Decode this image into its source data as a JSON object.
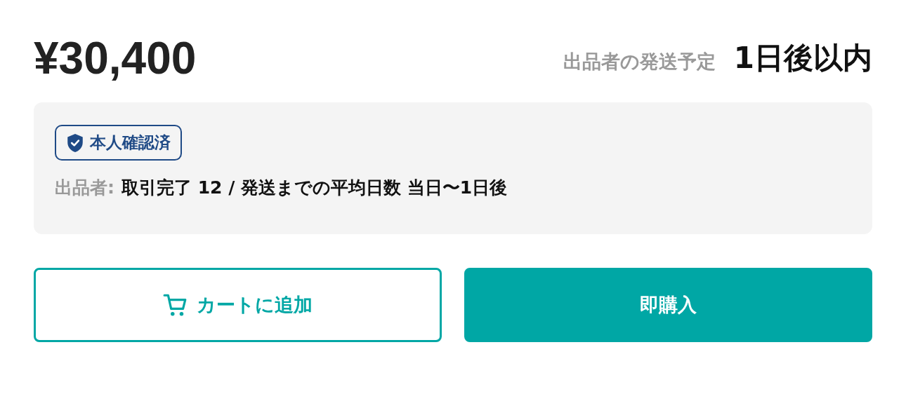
{
  "price": "¥30,400",
  "shipping": {
    "label": "出品者の発送予定",
    "value": "1日後以内"
  },
  "seller": {
    "verified_badge": "本人確認済",
    "label": "出品者:",
    "stats": "取引完了 12 / 発送までの平均日数 当日〜1日後"
  },
  "buttons": [
    {
      "kind": "outline",
      "label": "カートに追加"
    },
    {
      "kind": "filled",
      "label": "即購入"
    }
  ]
}
